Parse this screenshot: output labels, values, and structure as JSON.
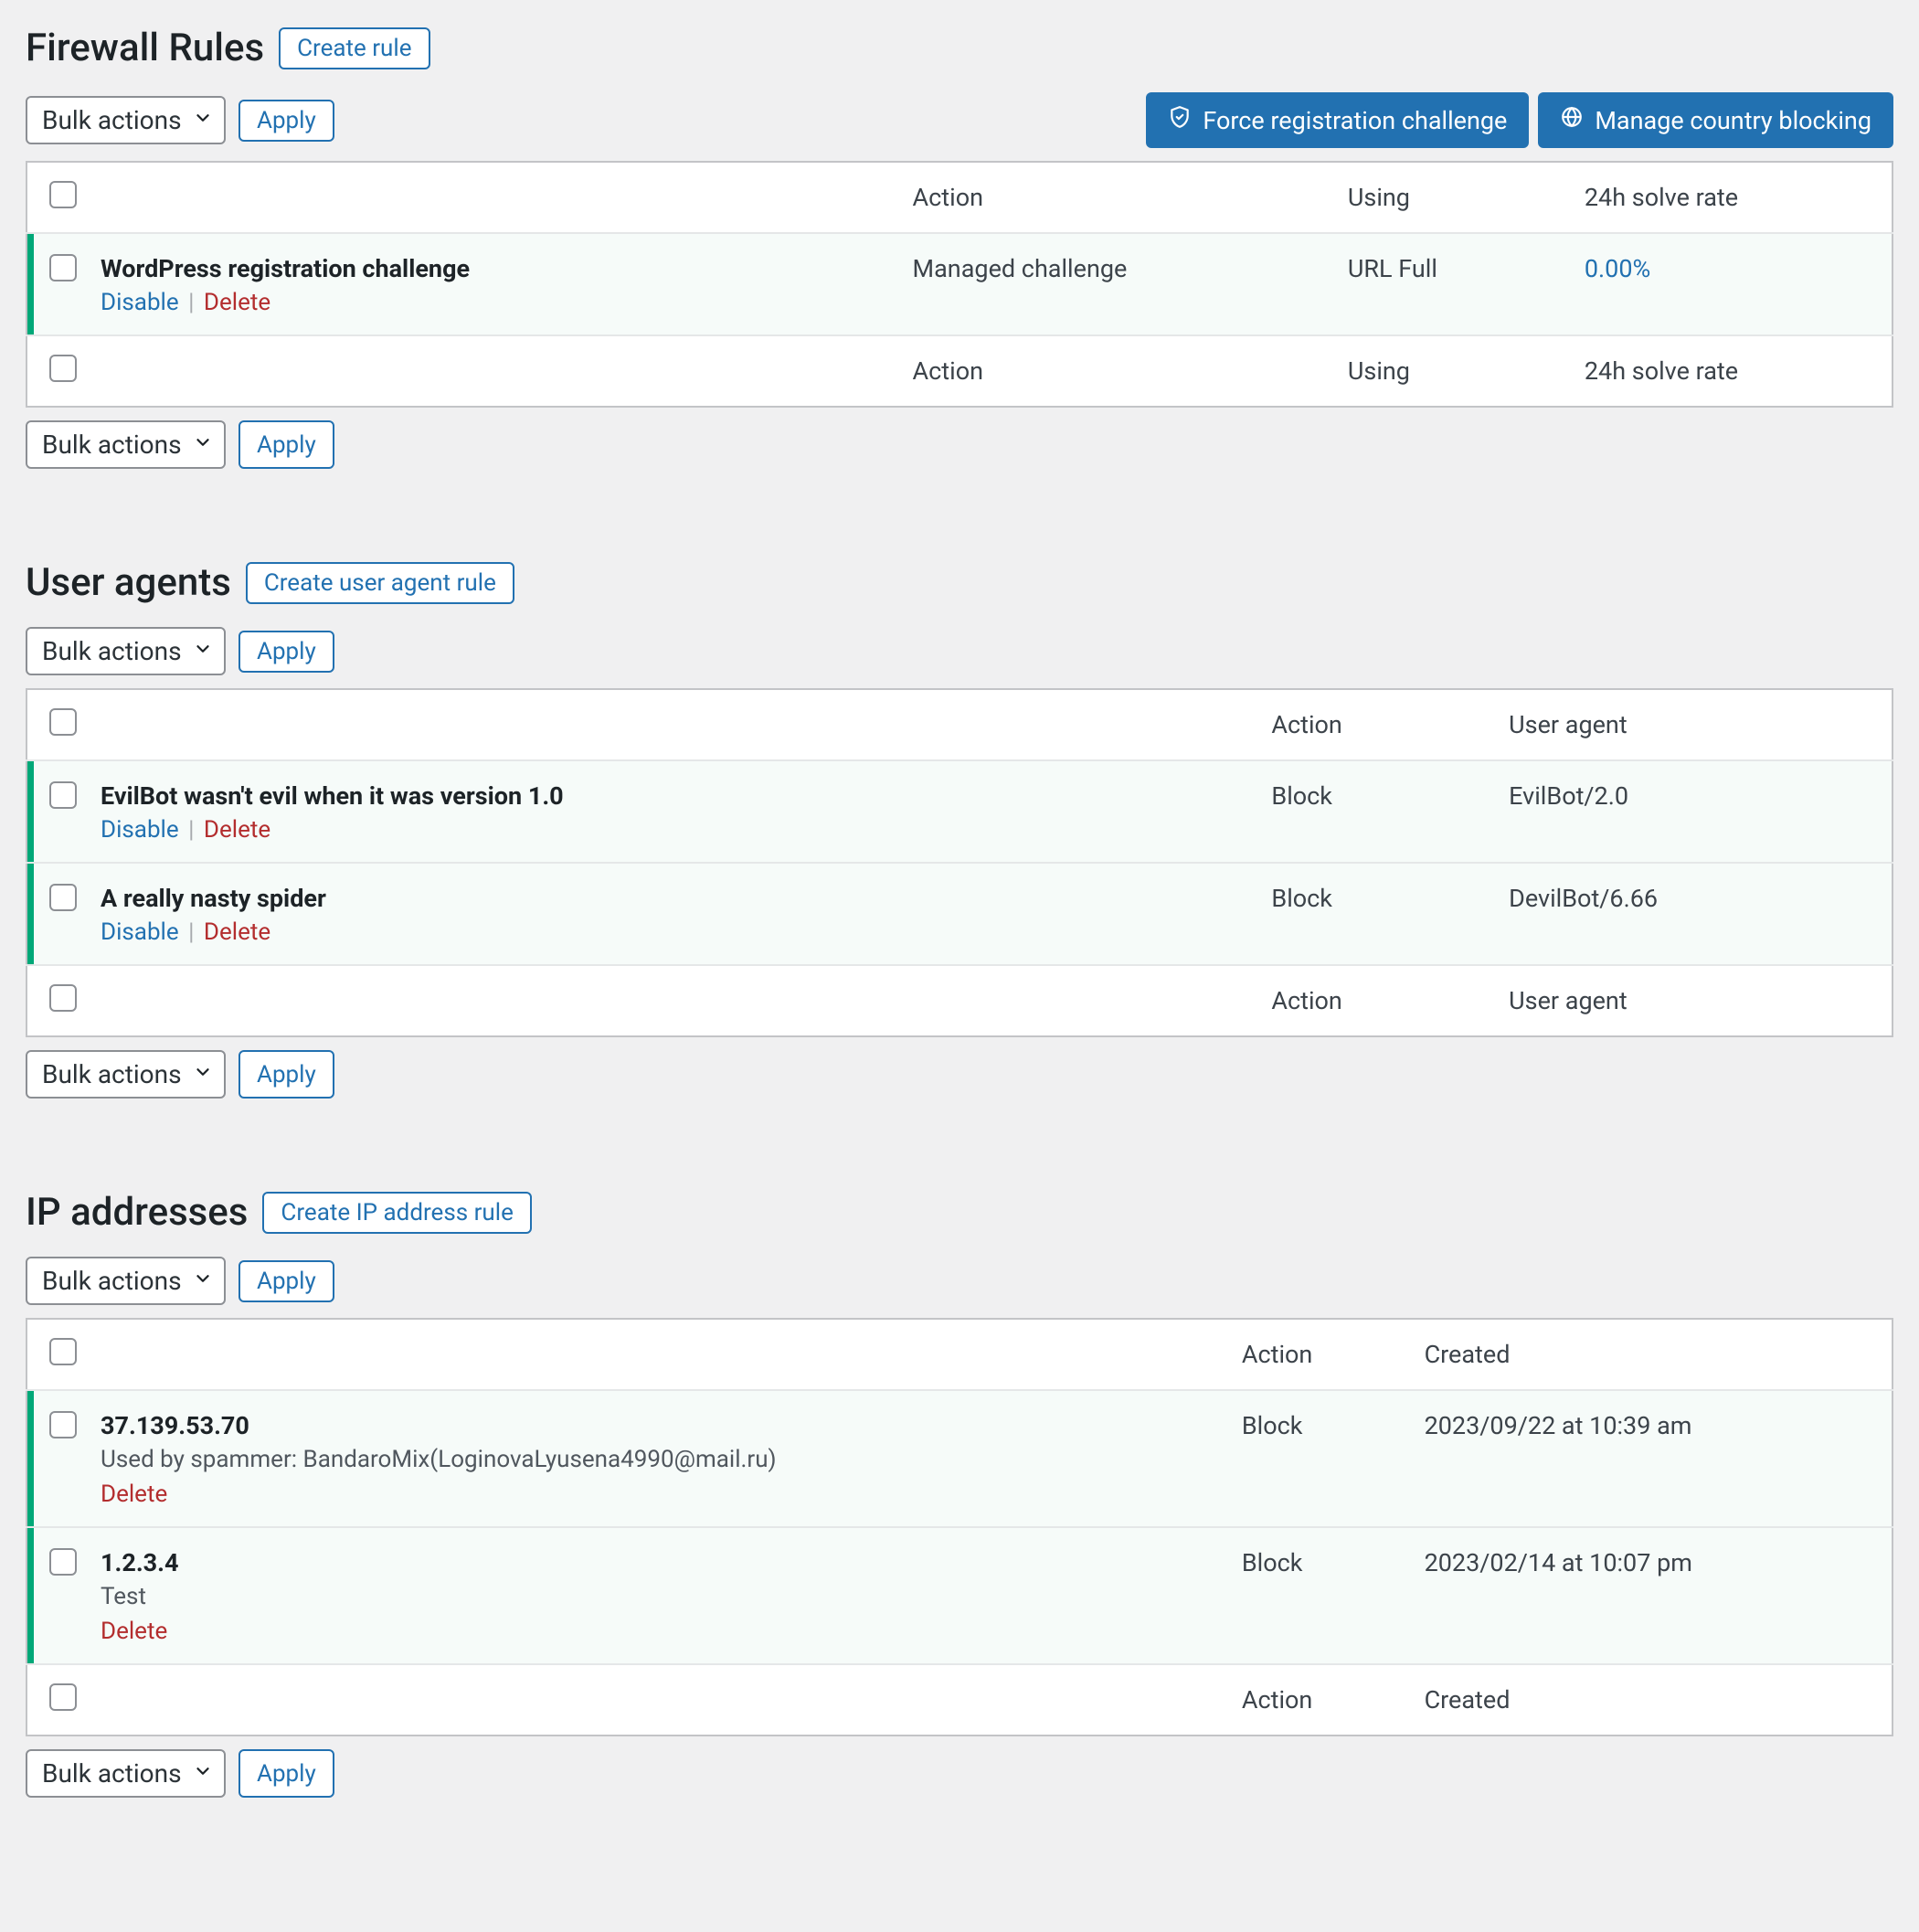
{
  "common": {
    "bulk_actions": "Bulk actions",
    "apply": "Apply",
    "disable": "Disable",
    "delete": "Delete"
  },
  "firewall": {
    "title": "Firewall Rules",
    "create_label": "Create rule",
    "force_registration": "Force registration challenge",
    "manage_country": "Manage country blocking",
    "headers": {
      "action": "Action",
      "using": "Using",
      "rate": "24h solve rate"
    },
    "rows": [
      {
        "name": "WordPress registration challenge",
        "action": "Managed challenge",
        "using": "URL Full",
        "rate": "0.00%"
      }
    ]
  },
  "user_agents": {
    "title": "User agents",
    "create_label": "Create user agent rule",
    "headers": {
      "action": "Action",
      "ua": "User agent"
    },
    "rows": [
      {
        "name": "EvilBot wasn't evil when it was version 1.0",
        "action": "Block",
        "ua": "EvilBot/2.0"
      },
      {
        "name": "A really nasty spider",
        "action": "Block",
        "ua": "DevilBot/6.66"
      }
    ]
  },
  "ip_addresses": {
    "title": "IP addresses",
    "create_label": "Create IP address rule",
    "headers": {
      "action": "Action",
      "created": "Created"
    },
    "rows": [
      {
        "ip": "37.139.53.70",
        "note": "Used by spammer: BandaroMix(LoginovaLyusena4990@mail.ru)",
        "action": "Block",
        "created": "2023/09/22 at 10:39 am"
      },
      {
        "ip": "1.2.3.4",
        "note": "Test",
        "action": "Block",
        "created": "2023/02/14 at 10:07 pm"
      }
    ]
  }
}
